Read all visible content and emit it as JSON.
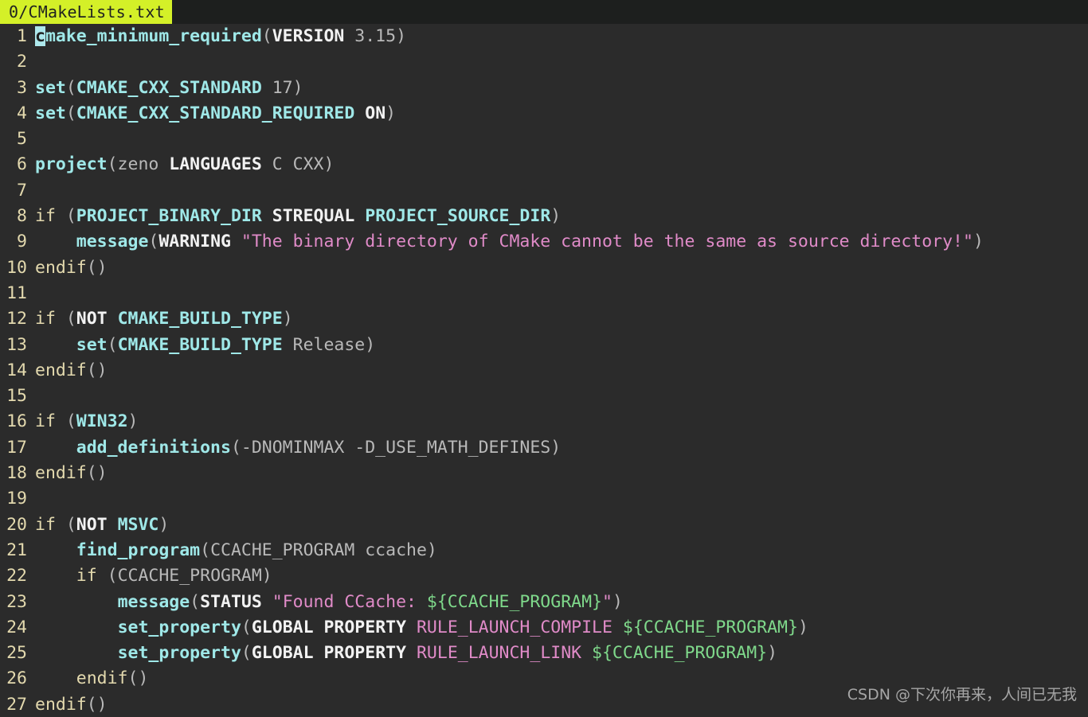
{
  "window": {
    "background": "#2b2b2b",
    "gutter_color": "#e3d9ae"
  },
  "tabbar": {
    "active_tab": "0/CMakeLists.txt",
    "active_bg": "#d4f028",
    "active_fg": "#1f2121",
    "bar_bg": "#1d1f1e"
  },
  "palette": {
    "function": "#9fe8e8",
    "keyword": "#f2f2f2",
    "control": "#e3d9ae",
    "variable": "#9fe8e8",
    "plain": "#b9b9b9",
    "string": "#e08bc8",
    "interpolation": "#7fd98b",
    "property": "#e08bc8",
    "cursor": "#aee8ec"
  },
  "editor": {
    "filename": "CMakeLists.txt",
    "language": "cmake",
    "cursor": {
      "line": 1,
      "column": 1,
      "char": "c"
    },
    "lines": [
      {
        "number": "1",
        "text": "cmake_minimum_required(VERSION 3.15)",
        "tokens": [
          {
            "t": "c",
            "c": "cursor"
          },
          {
            "t": "make_minimum_required",
            "c": "t-fn"
          },
          {
            "t": "(",
            "c": "t-punct"
          },
          {
            "t": "VERSION",
            "c": "t-kw"
          },
          {
            "t": " 3.15",
            "c": "t-num"
          },
          {
            "t": ")",
            "c": "t-punct"
          }
        ]
      },
      {
        "number": "2",
        "text": "",
        "tokens": []
      },
      {
        "number": "3",
        "text": "set(CMAKE_CXX_STANDARD 17)",
        "tokens": [
          {
            "t": "set",
            "c": "t-fn"
          },
          {
            "t": "(",
            "c": "t-punct"
          },
          {
            "t": "CMAKE_CXX_STANDARD",
            "c": "t-var"
          },
          {
            "t": " 17",
            "c": "t-num"
          },
          {
            "t": ")",
            "c": "t-punct"
          }
        ]
      },
      {
        "number": "4",
        "text": "set(CMAKE_CXX_STANDARD_REQUIRED ON)",
        "tokens": [
          {
            "t": "set",
            "c": "t-fn"
          },
          {
            "t": "(",
            "c": "t-punct"
          },
          {
            "t": "CMAKE_CXX_STANDARD_REQUIRED",
            "c": "t-var"
          },
          {
            "t": " ",
            "c": "t-plain"
          },
          {
            "t": "ON",
            "c": "t-kw"
          },
          {
            "t": ")",
            "c": "t-punct"
          }
        ]
      },
      {
        "number": "5",
        "text": "",
        "tokens": []
      },
      {
        "number": "6",
        "text": "project(zeno LANGUAGES C CXX)",
        "tokens": [
          {
            "t": "project",
            "c": "t-fn"
          },
          {
            "t": "(zeno ",
            "c": "t-plain"
          },
          {
            "t": "LANGUAGES",
            "c": "t-kw"
          },
          {
            "t": " C CXX)",
            "c": "t-plain"
          }
        ]
      },
      {
        "number": "7",
        "text": "",
        "tokens": []
      },
      {
        "number": "8",
        "text": "if (PROJECT_BINARY_DIR STREQUAL PROJECT_SOURCE_DIR)",
        "tokens": [
          {
            "t": "if ",
            "c": "t-ctrl"
          },
          {
            "t": "(",
            "c": "t-punct"
          },
          {
            "t": "PROJECT_BINARY_DIR",
            "c": "t-var"
          },
          {
            "t": " ",
            "c": "t-plain"
          },
          {
            "t": "STREQUAL",
            "c": "t-kw"
          },
          {
            "t": " ",
            "c": "t-plain"
          },
          {
            "t": "PROJECT_SOURCE_DIR",
            "c": "t-var"
          },
          {
            "t": ")",
            "c": "t-punct"
          }
        ]
      },
      {
        "number": "9",
        "text": "    message(WARNING \"The binary directory of CMake cannot be the same as source directory!\")",
        "tokens": [
          {
            "t": "    ",
            "c": "t-plain"
          },
          {
            "t": "message",
            "c": "t-fn"
          },
          {
            "t": "(",
            "c": "t-punct"
          },
          {
            "t": "WARNING",
            "c": "t-kw"
          },
          {
            "t": " ",
            "c": "t-plain"
          },
          {
            "t": "\"The binary directory of CMake cannot be the same as source directory!\"",
            "c": "t-str"
          },
          {
            "t": ")",
            "c": "t-punct"
          }
        ]
      },
      {
        "number": "10",
        "text": "endif()",
        "tokens": [
          {
            "t": "endif",
            "c": "t-ctrl"
          },
          {
            "t": "()",
            "c": "t-punct"
          }
        ]
      },
      {
        "number": "11",
        "text": "",
        "tokens": []
      },
      {
        "number": "12",
        "text": "if (NOT CMAKE_BUILD_TYPE)",
        "tokens": [
          {
            "t": "if ",
            "c": "t-ctrl"
          },
          {
            "t": "(",
            "c": "t-punct"
          },
          {
            "t": "NOT",
            "c": "t-kw"
          },
          {
            "t": " ",
            "c": "t-plain"
          },
          {
            "t": "CMAKE_BUILD_TYPE",
            "c": "t-var"
          },
          {
            "t": ")",
            "c": "t-punct"
          }
        ]
      },
      {
        "number": "13",
        "text": "    set(CMAKE_BUILD_TYPE Release)",
        "tokens": [
          {
            "t": "    ",
            "c": "t-plain"
          },
          {
            "t": "set",
            "c": "t-fn"
          },
          {
            "t": "(",
            "c": "t-punct"
          },
          {
            "t": "CMAKE_BUILD_TYPE",
            "c": "t-var"
          },
          {
            "t": " Release)",
            "c": "t-plain"
          }
        ]
      },
      {
        "number": "14",
        "text": "endif()",
        "tokens": [
          {
            "t": "endif",
            "c": "t-ctrl"
          },
          {
            "t": "()",
            "c": "t-punct"
          }
        ]
      },
      {
        "number": "15",
        "text": "",
        "tokens": []
      },
      {
        "number": "16",
        "text": "if (WIN32)",
        "tokens": [
          {
            "t": "if ",
            "c": "t-ctrl"
          },
          {
            "t": "(",
            "c": "t-punct"
          },
          {
            "t": "WIN32",
            "c": "t-var"
          },
          {
            "t": ")",
            "c": "t-punct"
          }
        ]
      },
      {
        "number": "17",
        "text": "    add_definitions(-DNOMINMAX -D_USE_MATH_DEFINES)",
        "tokens": [
          {
            "t": "    ",
            "c": "t-plain"
          },
          {
            "t": "add_definitions",
            "c": "t-fn"
          },
          {
            "t": "(-DNOMINMAX -D_USE_MATH_DEFINES)",
            "c": "t-plain"
          }
        ]
      },
      {
        "number": "18",
        "text": "endif()",
        "tokens": [
          {
            "t": "endif",
            "c": "t-ctrl"
          },
          {
            "t": "()",
            "c": "t-punct"
          }
        ]
      },
      {
        "number": "19",
        "text": "",
        "tokens": []
      },
      {
        "number": "20",
        "text": "if (NOT MSVC)",
        "tokens": [
          {
            "t": "if ",
            "c": "t-ctrl"
          },
          {
            "t": "(",
            "c": "t-punct"
          },
          {
            "t": "NOT",
            "c": "t-kw"
          },
          {
            "t": " ",
            "c": "t-plain"
          },
          {
            "t": "MSVC",
            "c": "t-var"
          },
          {
            "t": ")",
            "c": "t-punct"
          }
        ]
      },
      {
        "number": "21",
        "text": "    find_program(CCACHE_PROGRAM ccache)",
        "tokens": [
          {
            "t": "    ",
            "c": "t-plain"
          },
          {
            "t": "find_program",
            "c": "t-fn"
          },
          {
            "t": "(CCACHE_PROGRAM ccache)",
            "c": "t-plain"
          }
        ]
      },
      {
        "number": "22",
        "text": "    if (CCACHE_PROGRAM)",
        "tokens": [
          {
            "t": "    ",
            "c": "t-plain"
          },
          {
            "t": "if ",
            "c": "t-ctrl"
          },
          {
            "t": "(CCACHE_PROGRAM)",
            "c": "t-plain"
          }
        ]
      },
      {
        "number": "23",
        "text": "        message(STATUS \"Found CCache: ${CCACHE_PROGRAM}\")",
        "tokens": [
          {
            "t": "        ",
            "c": "t-plain"
          },
          {
            "t": "message",
            "c": "t-fn"
          },
          {
            "t": "(",
            "c": "t-punct"
          },
          {
            "t": "STATUS",
            "c": "t-kw"
          },
          {
            "t": " ",
            "c": "t-plain"
          },
          {
            "t": "\"Found CCache: ",
            "c": "t-str"
          },
          {
            "t": "${CCACHE_PROGRAM}",
            "c": "t-interp"
          },
          {
            "t": "\"",
            "c": "t-str"
          },
          {
            "t": ")",
            "c": "t-punct"
          }
        ]
      },
      {
        "number": "24",
        "text": "        set_property(GLOBAL PROPERTY RULE_LAUNCH_COMPILE ${CCACHE_PROGRAM})",
        "tokens": [
          {
            "t": "        ",
            "c": "t-plain"
          },
          {
            "t": "set_property",
            "c": "t-fn"
          },
          {
            "t": "(",
            "c": "t-punct"
          },
          {
            "t": "GLOBAL PROPERTY",
            "c": "t-kw"
          },
          {
            "t": " ",
            "c": "t-plain"
          },
          {
            "t": "RULE_LAUNCH_COMPILE",
            "c": "t-prop"
          },
          {
            "t": " ",
            "c": "t-plain"
          },
          {
            "t": "${CCACHE_PROGRAM}",
            "c": "t-interp"
          },
          {
            "t": ")",
            "c": "t-punct"
          }
        ]
      },
      {
        "number": "25",
        "text": "        set_property(GLOBAL PROPERTY RULE_LAUNCH_LINK ${CCACHE_PROGRAM})",
        "tokens": [
          {
            "t": "        ",
            "c": "t-plain"
          },
          {
            "t": "set_property",
            "c": "t-fn"
          },
          {
            "t": "(",
            "c": "t-punct"
          },
          {
            "t": "GLOBAL PROPERTY",
            "c": "t-kw"
          },
          {
            "t": " ",
            "c": "t-plain"
          },
          {
            "t": "RULE_LAUNCH_LINK",
            "c": "t-prop"
          },
          {
            "t": " ",
            "c": "t-plain"
          },
          {
            "t": "${CCACHE_PROGRAM}",
            "c": "t-interp"
          },
          {
            "t": ")",
            "c": "t-punct"
          }
        ]
      },
      {
        "number": "26",
        "text": "    endif()",
        "tokens": [
          {
            "t": "    ",
            "c": "t-plain"
          },
          {
            "t": "endif",
            "c": "t-ctrl"
          },
          {
            "t": "()",
            "c": "t-punct"
          }
        ]
      },
      {
        "number": "27",
        "text": "endif()",
        "tokens": [
          {
            "t": "endif",
            "c": "t-ctrl"
          },
          {
            "t": "()",
            "c": "t-punct"
          }
        ]
      }
    ]
  },
  "watermark": {
    "text": "CSDN @下次你再来，人间已无我"
  }
}
